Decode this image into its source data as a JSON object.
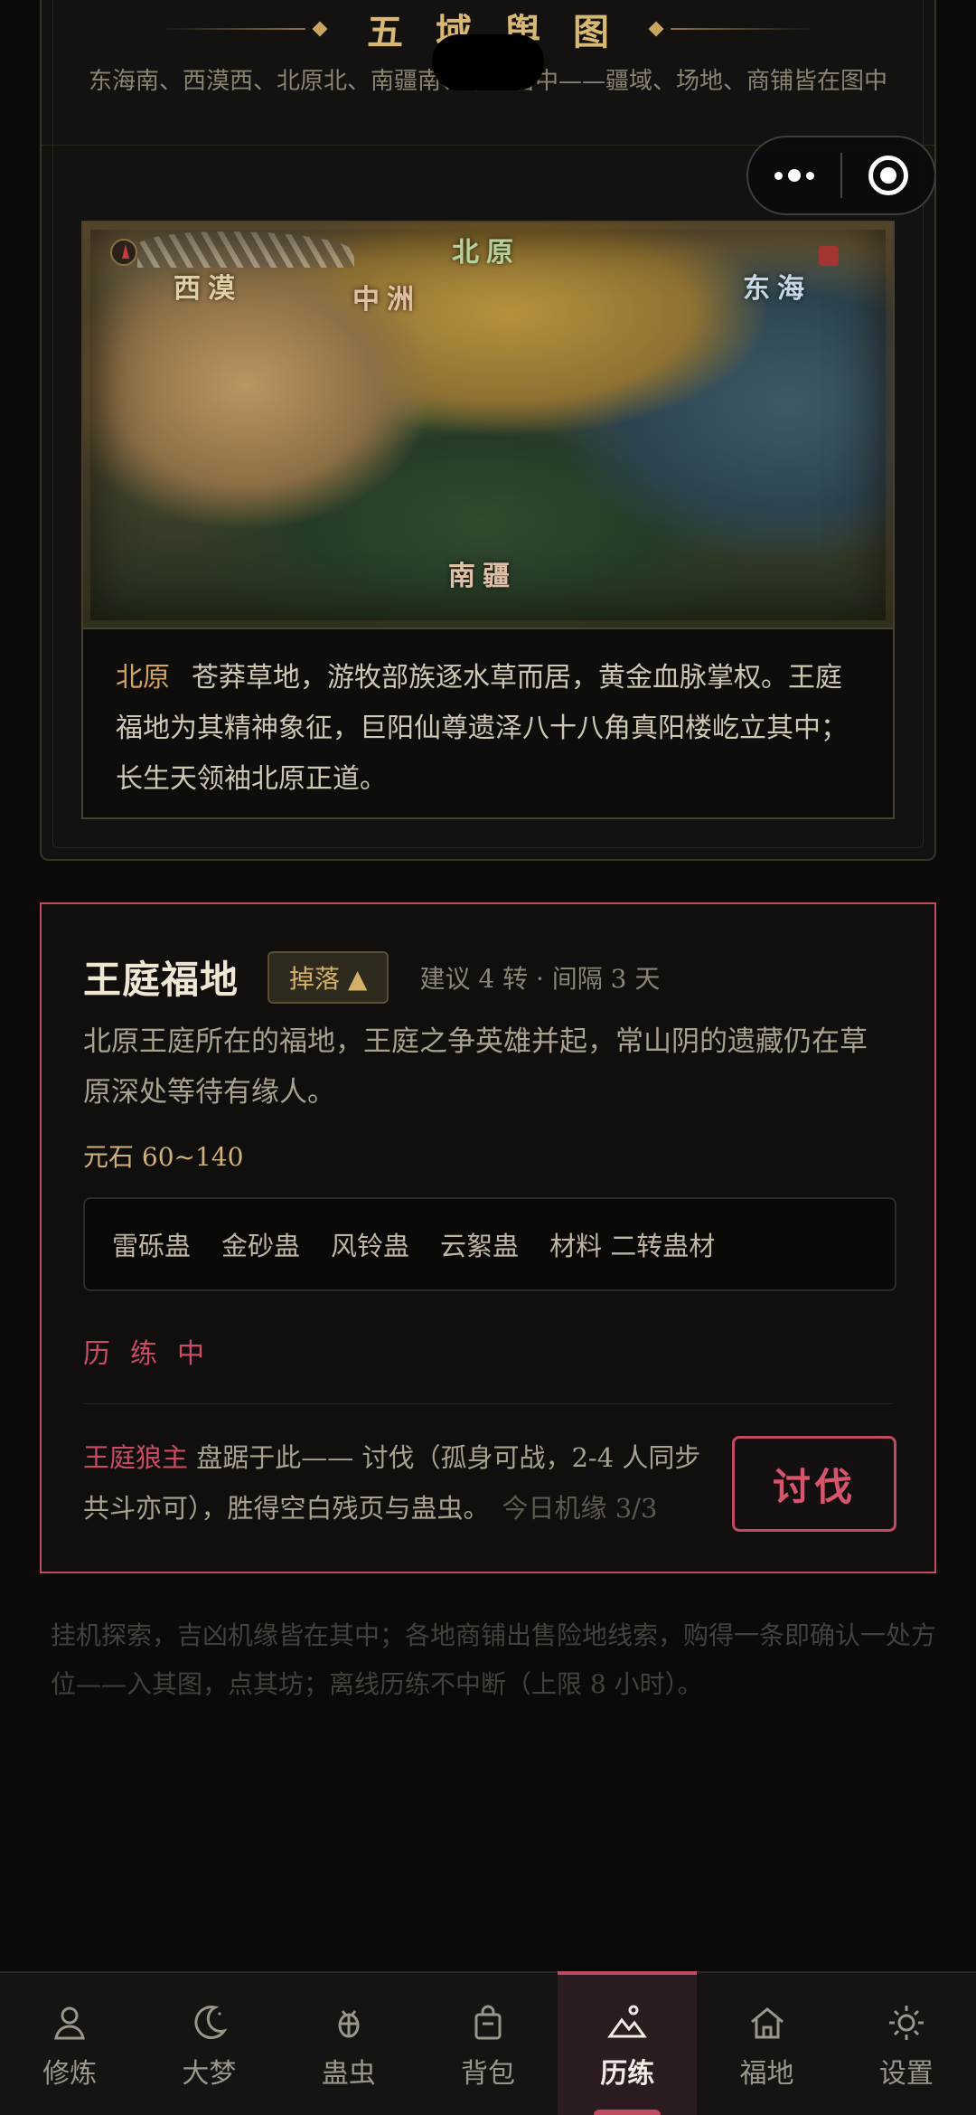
{
  "map_section": {
    "title": "五域舆图",
    "subtitle": "东海南、西漠西、北原北、南疆南、中洲居中——疆域、场地、商铺皆在图中",
    "labels": {
      "north": "北原",
      "west": "西漠",
      "center": "中洲",
      "east": "东海",
      "south": "南疆"
    },
    "region_name": "北原",
    "region_desc": "苍莽草地，游牧部族逐水草而居，黄金血脉掌权。王庭福地为其精神象征，巨阳仙尊遗泽八十八角真阳楼屹立其中；长生天领袖北原正道。"
  },
  "location": {
    "name": "王庭福地",
    "drop_label": "掉落 ▲",
    "meta": "建议 4 转 · 间隔 3 天",
    "desc": "北原王庭所在的福地，王庭之争英雄并起，常山阴的遗藏仍在草原深处等待有缘人。",
    "stone": "元石 60~140",
    "loot": [
      "雷砾蛊",
      "金砂蛊",
      "风铃蛊",
      "云絮蛊",
      "材料 二转蛊材"
    ],
    "status": "历练中",
    "boss_name": "王庭狼主",
    "boss_text": " 盘踞于此—— 讨伐（孤身可战，2-4 人同步共斗亦可），胜得空白残页与蛊虫。",
    "chance": "今日机缘 3/3",
    "attack_label": "讨伐"
  },
  "footer_note": "挂机探索，吉凶机缘皆在其中；各地商铺出售险地线索，购得一条即确认一处方位——入其图，点其坊；离线历练不中断（上限 8 小时）。",
  "tabs": [
    {
      "label": "修炼",
      "icon": "person-icon"
    },
    {
      "label": "大梦",
      "icon": "moon-icon"
    },
    {
      "label": "蛊虫",
      "icon": "bug-icon"
    },
    {
      "label": "背包",
      "icon": "bag-icon"
    },
    {
      "label": "历练",
      "icon": "mountain-icon",
      "active": true
    },
    {
      "label": "福地",
      "icon": "home-icon"
    },
    {
      "label": "设置",
      "icon": "sun-icon"
    }
  ],
  "colors": {
    "accent": "#c04a60",
    "gold": "#d8b873",
    "background": "#0b0a09"
  }
}
